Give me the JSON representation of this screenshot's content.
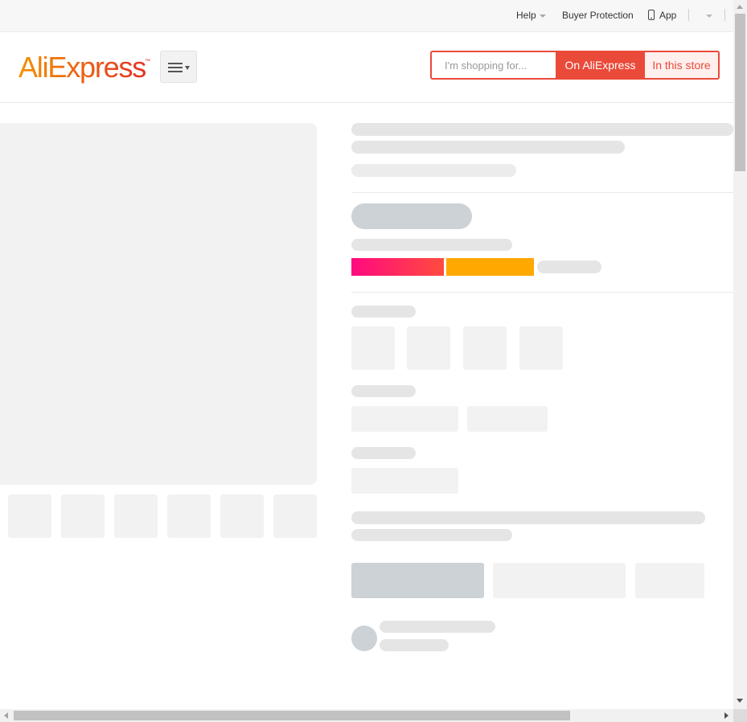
{
  "topbar": {
    "help_label": "Help",
    "buyer_protection_label": "Buyer Protection",
    "app_label": "App"
  },
  "header": {
    "logo_text_part1": "Ali",
    "logo_text_part2": "Express",
    "logo_trademark": "™",
    "search": {
      "placeholder": "I'm shopping for...",
      "value": "",
      "on_aliexpress_label": "On AliExpress",
      "in_this_store_label": "In this store"
    }
  },
  "colors": {
    "brand_red": "#ea4a3a",
    "logo_orange": "#f39200",
    "logo_red": "#e43225",
    "price_pink": "#ff0a7f",
    "price_orange": "#ffa800",
    "skeleton_gray": "#e5e5e5",
    "skeleton_light": "#f2f2f2",
    "skeleton_blue": "#ccd2d6"
  },
  "page_state": "loading-skeleton"
}
